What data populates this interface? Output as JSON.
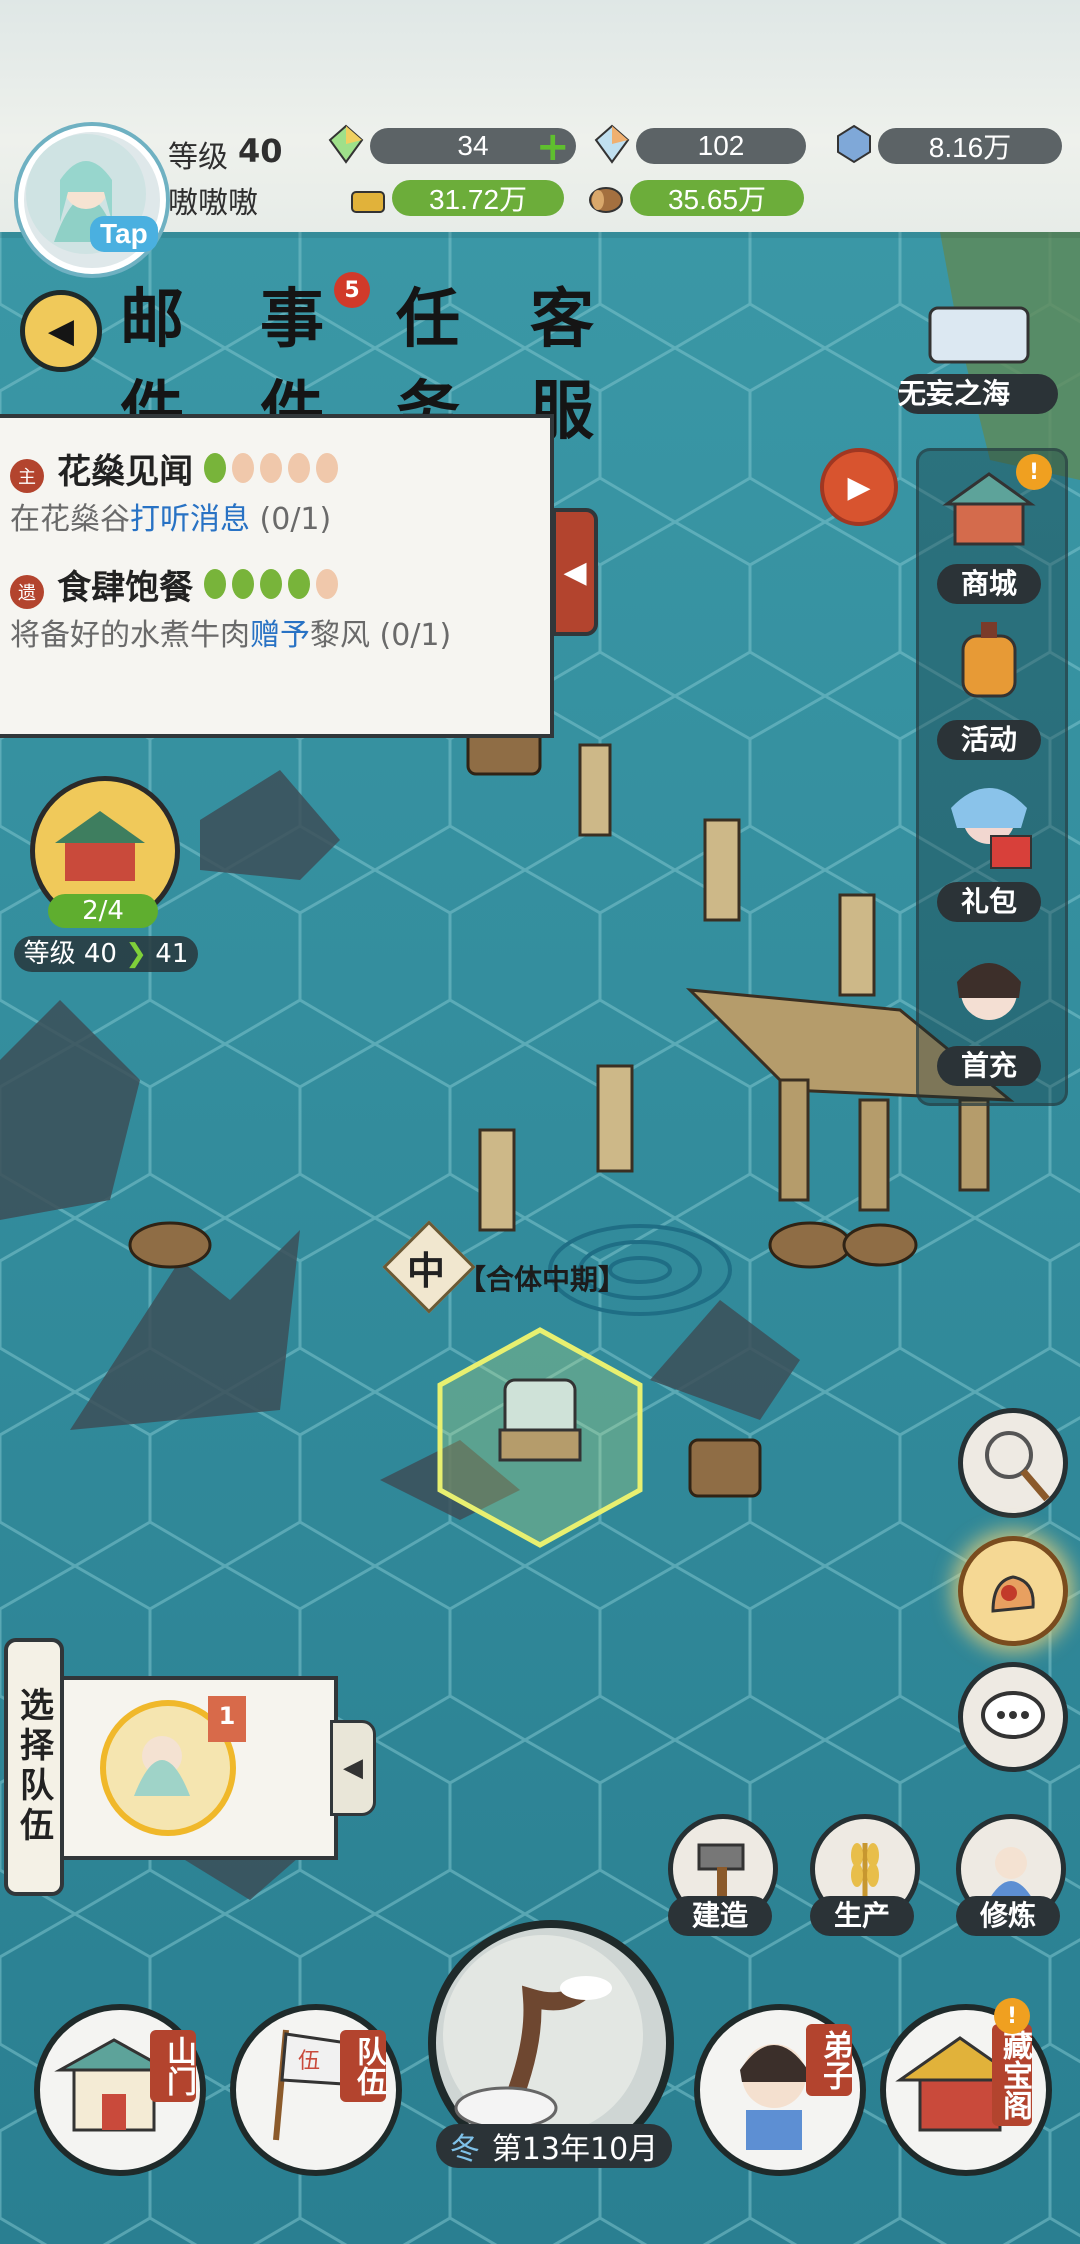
{
  "player": {
    "level_label": "等级",
    "level": "40",
    "name": "嗷嗷嗷",
    "tap_label": "Tap"
  },
  "resources": [
    {
      "icon": "rainbow-crystal-icon",
      "value": "34"
    },
    {
      "icon": "rainbow-crystal-locked-icon",
      "value": "102"
    },
    {
      "icon": "blue-crystal-icon",
      "value": "8.16万"
    },
    {
      "icon": "gold-icon",
      "value": "31.72万"
    },
    {
      "icon": "wood-icon",
      "value": "35.65万"
    }
  ],
  "tabs": [
    {
      "label": "邮件",
      "badge": ""
    },
    {
      "label": "事件",
      "badge": "5"
    },
    {
      "label": "任务",
      "badge": ""
    },
    {
      "label": "客服",
      "badge": ""
    }
  ],
  "quests": [
    {
      "tag": "主",
      "title": "花燊见闻",
      "desc_prefix": "在花燊谷",
      "desc_highlight": "打听消息",
      "desc_suffix": " (0/1)",
      "progress": 1,
      "total": 5
    },
    {
      "tag": "遗",
      "title": "食肆饱餐",
      "desc_prefix": "将备好的水煮牛肉",
      "desc_highlight": "赠予",
      "desc_suffix": "黎风 (0/1)",
      "progress": 4,
      "total": 5
    }
  ],
  "sect": {
    "progress": "2/4",
    "level_label": "等级",
    "level_from": "40",
    "level_to": "41"
  },
  "right_sidebar": {
    "region": "无妄之海",
    "items": [
      {
        "label": "商城",
        "icon": "shop-icon",
        "alert": true
      },
      {
        "label": "活动",
        "icon": "lantern-icon",
        "alert": false
      },
      {
        "label": "礼包",
        "icon": "gift-icon",
        "alert": false
      },
      {
        "label": "首充",
        "icon": "first-recharge-icon",
        "alert": false
      }
    ]
  },
  "map": {
    "stage_marker": "中",
    "stage_label": "【合体中期】"
  },
  "team": {
    "select_label": "选择队伍",
    "flag_number": "1"
  },
  "actions": [
    {
      "label": "建造",
      "icon": "hammer-icon"
    },
    {
      "label": "生产",
      "icon": "wheat-icon"
    },
    {
      "label": "修炼",
      "icon": "cultivate-icon"
    }
  ],
  "bottom_nav": {
    "items": [
      {
        "label": "山门",
        "icon": "gate-icon"
      },
      {
        "label": "队伍",
        "icon": "flag-icon"
      },
      {
        "label": "弟子",
        "icon": "disciple-icon"
      },
      {
        "label": "藏宝阁",
        "icon": "treasure-pavilion-icon"
      }
    ],
    "season": "冬",
    "date": "第13年10月"
  },
  "colors": {
    "sea": "#2f8a9a",
    "panel_border": "#31373a",
    "tag_red": "#b3442e",
    "green": "#6cad3a",
    "highlight_blue": "#2872c4"
  }
}
